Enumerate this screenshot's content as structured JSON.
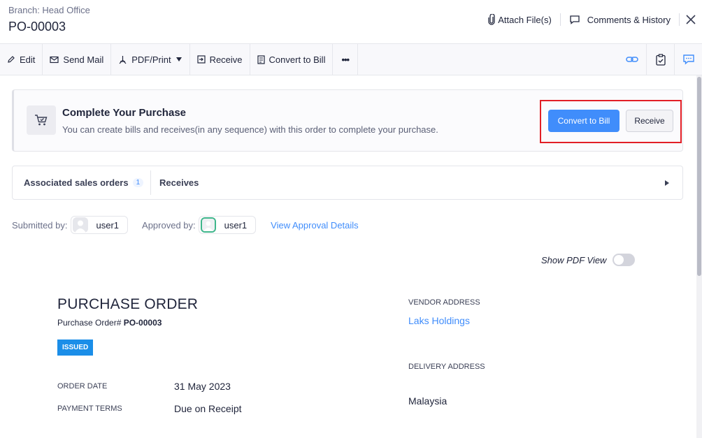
{
  "header": {
    "branch": "Branch: Head Office",
    "title": "PO-00003",
    "attach_label": "Attach File(s)",
    "comments_label": "Comments & History"
  },
  "toolbar": {
    "edit": "Edit",
    "send_mail": "Send Mail",
    "pdf_print": "PDF/Print",
    "receive": "Receive",
    "convert": "Convert to Bill",
    "more": "•••"
  },
  "banner": {
    "title": "Complete Your Purchase",
    "subtitle": "You can create bills and receives(in any sequence) with this order to complete your purchase.",
    "primary_label": "Convert to Bill",
    "secondary_label": "Receive"
  },
  "associations": {
    "sales_orders_label": "Associated sales orders",
    "sales_orders_count": "1",
    "receives_label": "Receives"
  },
  "people": {
    "submitted_label": "Submitted by:",
    "submitted_user": "user1",
    "approved_label": "Approved by:",
    "approved_user": "user1",
    "approval_link": "View Approval Details"
  },
  "pdf_view": {
    "label": "Show PDF View",
    "enabled": false
  },
  "document": {
    "title": "PURCHASE ORDER",
    "number_label": "Purchase Order# ",
    "number": "PO-00003",
    "status": "ISSUED",
    "order_date_label": "ORDER DATE",
    "order_date": "31 May 2023",
    "payment_terms_label": "PAYMENT TERMS",
    "payment_terms": "Due on Receipt",
    "vendor_address_label": "VENDOR ADDRESS",
    "vendor_name": "Laks Holdings",
    "delivery_address_label": "DELIVERY ADDRESS",
    "delivery_country": "Malaysia"
  },
  "colors": {
    "accent": "#408dfb",
    "status_badge": "#1b8ee8",
    "highlight": "#e21f26"
  }
}
